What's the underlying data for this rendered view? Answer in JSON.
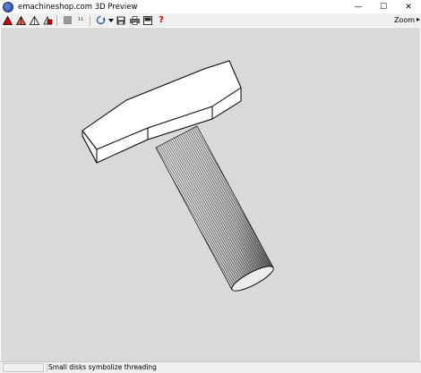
{
  "window": {
    "title": "emachineshop.com 3D Preview",
    "controls": {
      "minimize": "—",
      "maximize": "☐",
      "close": "✕"
    }
  },
  "toolbar": {
    "zoom_label": "Zoom",
    "icons": [
      "view-solid-icon",
      "view-shaded-icon",
      "view-wireframe-icon",
      "view-hidden-lines-icon",
      "stop-icon",
      "counter-icon",
      "rotate-icon",
      "dropdown-arrow-icon",
      "save-image-icon",
      "print-icon",
      "export-icon",
      "help-icon"
    ],
    "counter_glyph": "¹¹",
    "help_glyph": "?",
    "accent_red": "#cc0000"
  },
  "viewport": {
    "background": "#d9d9d9"
  },
  "status": {
    "message": "Small disks symbolize threading"
  }
}
